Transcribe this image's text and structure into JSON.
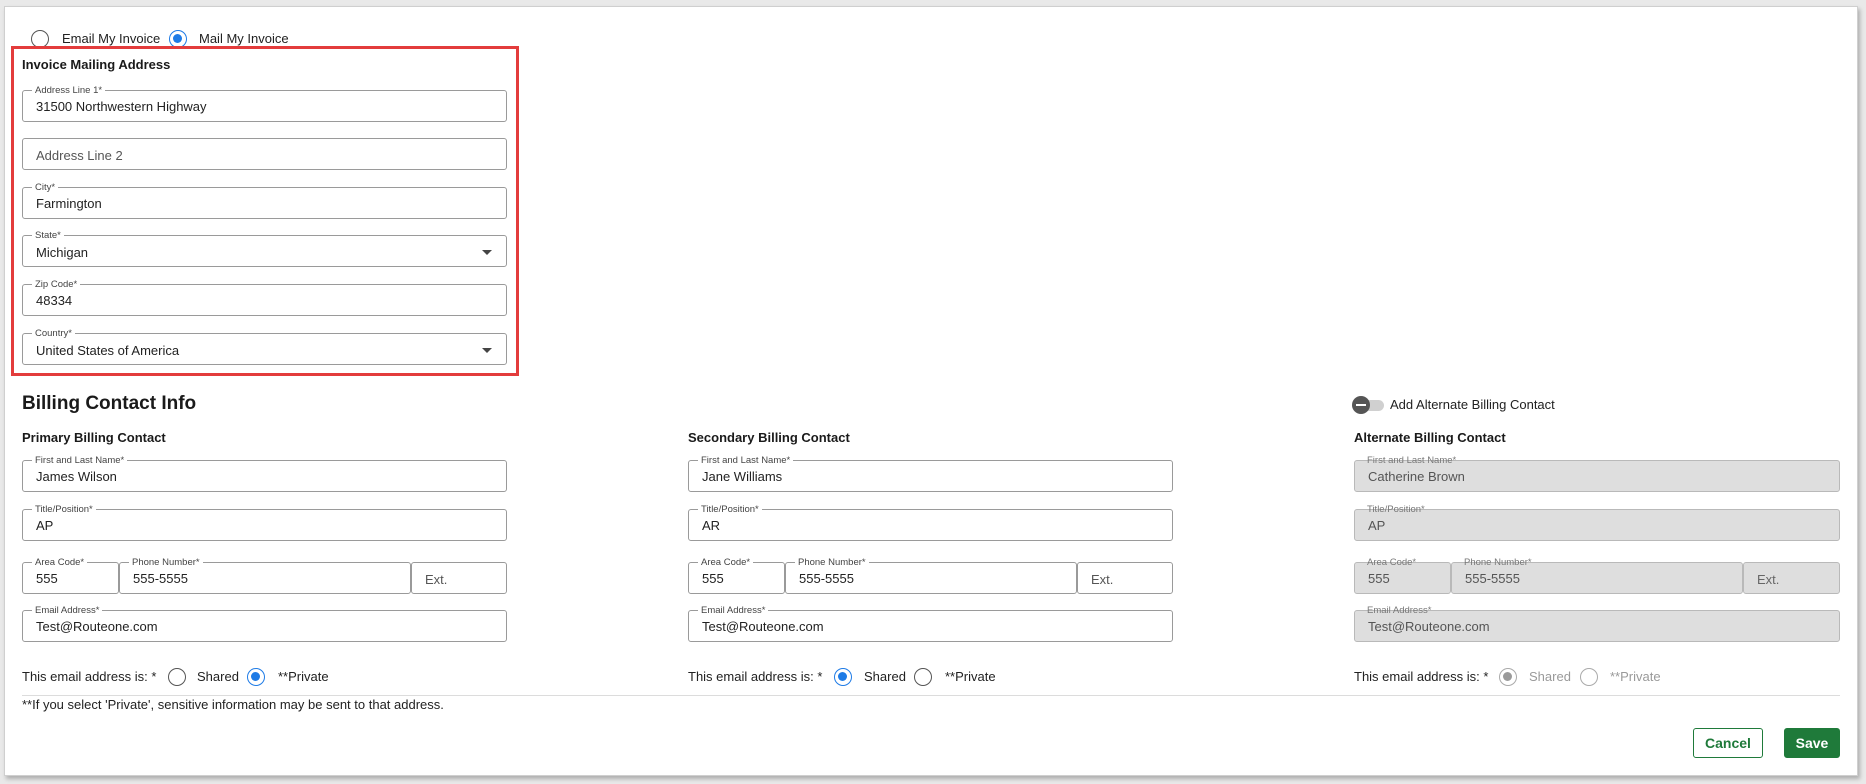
{
  "delivery": {
    "email_label": "Email My Invoice",
    "mail_label": "Mail My Invoice",
    "selected": "mail"
  },
  "mailing": {
    "heading": "Invoice Mailing Address",
    "address1_label": "Address Line 1*",
    "address1_value": "31500 Northwestern Highway",
    "address2_placeholder": "Address Line 2",
    "city_label": "City*",
    "city_value": "Farmington",
    "state_label": "State*",
    "state_value": "Michigan",
    "zip_label": "Zip Code*",
    "zip_value": "48334",
    "country_label": "Country*",
    "country_value": "United States of America"
  },
  "billing": {
    "heading": "Billing Contact Info",
    "toggle_label": "Add Alternate Billing Contact",
    "email_question": "This email address is: *",
    "shared_label": "Shared",
    "private_label": "**Private",
    "name_label": "First and Last Name*",
    "title_label": "Title/Position*",
    "area_label": "Area Code*",
    "phone_label": "Phone Number*",
    "ext_placeholder": "Ext.",
    "email_label": "Email Address*",
    "primary": {
      "heading": "Primary Billing Contact",
      "name": "James Wilson",
      "title": "AP",
      "area": "555",
      "phone": "555-5555",
      "email": "Test@Routeone.com",
      "email_type": "private"
    },
    "secondary": {
      "heading": "Secondary Billing Contact",
      "name": "Jane Williams",
      "title": "AR",
      "area": "555",
      "phone": "555-5555",
      "email": "Test@Routeone.com",
      "email_type": "shared"
    },
    "alternate": {
      "heading": "Alternate Billing Contact",
      "name": "Catherine Brown",
      "title": "AP",
      "area": "555",
      "phone": "555-5555",
      "email": "Test@Routeone.com",
      "email_type": "shared",
      "disabled": true
    }
  },
  "footer": {
    "note": "**If you select 'Private', sensitive information may be sent to that address.",
    "cancel_label": "Cancel",
    "save_label": "Save"
  },
  "colors": {
    "accent_blue": "#1e7be6",
    "primary_green": "#1f7a3a",
    "highlight_red": "#e33c3c"
  }
}
